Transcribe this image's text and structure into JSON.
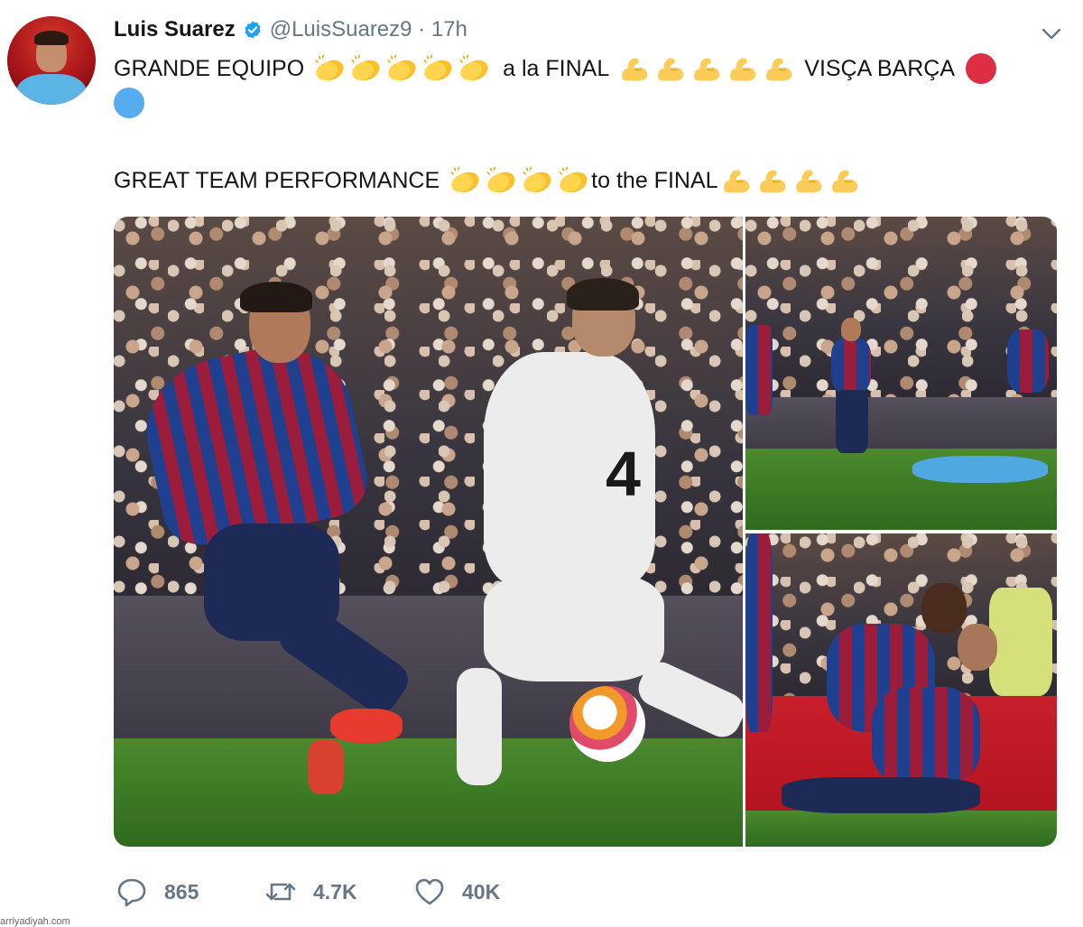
{
  "tweet": {
    "author_name": "Luis Suarez",
    "handle": "@LuisSuarez9",
    "separator": " · ",
    "time": "17h",
    "line1": {
      "part1": "GRANDE EQUIPO",
      "part2": "a la FINAL",
      "part3": "VISÇA BARÇA"
    },
    "line2": {
      "part1": "GREAT TEAM PERFORMANCE",
      "part2": "to the FINAL"
    },
    "icons": {
      "clap": "clapping-hands-emoji",
      "muscle": "flexed-biceps-emoji",
      "red_circle": "red-circle-emoji",
      "blue_circle": "blue-circle-emoji"
    },
    "colors": {
      "verified": "#1da1f2",
      "red_circle": "#dd2e44",
      "blue_circle": "#55acee",
      "secondary_text": "#657786"
    }
  },
  "actions": {
    "replies": "865",
    "retweets": "4.7K",
    "likes": "40K"
  },
  "watermark": "arriyadiyah.com"
}
